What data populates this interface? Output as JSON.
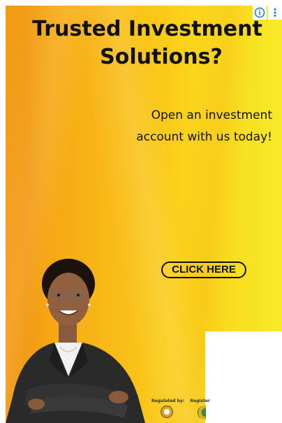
{
  "ad": {
    "headline_line1": "Trusted Investment",
    "headline_line2": "Solutions?",
    "subtext_line1": "Open an investment",
    "subtext_line2": "account with us today!",
    "cta_label": "CLICK HERE",
    "regulated_by": "Regulated by:",
    "registered_with": "Register"
  },
  "badges": {
    "info_icon": "info-icon",
    "menu_icon": "vertical-dots-icon"
  },
  "colors": {
    "background_left": "#f39a12",
    "background_right": "#f7ea26",
    "text": "#111111",
    "badge": "#1e6fd9"
  }
}
